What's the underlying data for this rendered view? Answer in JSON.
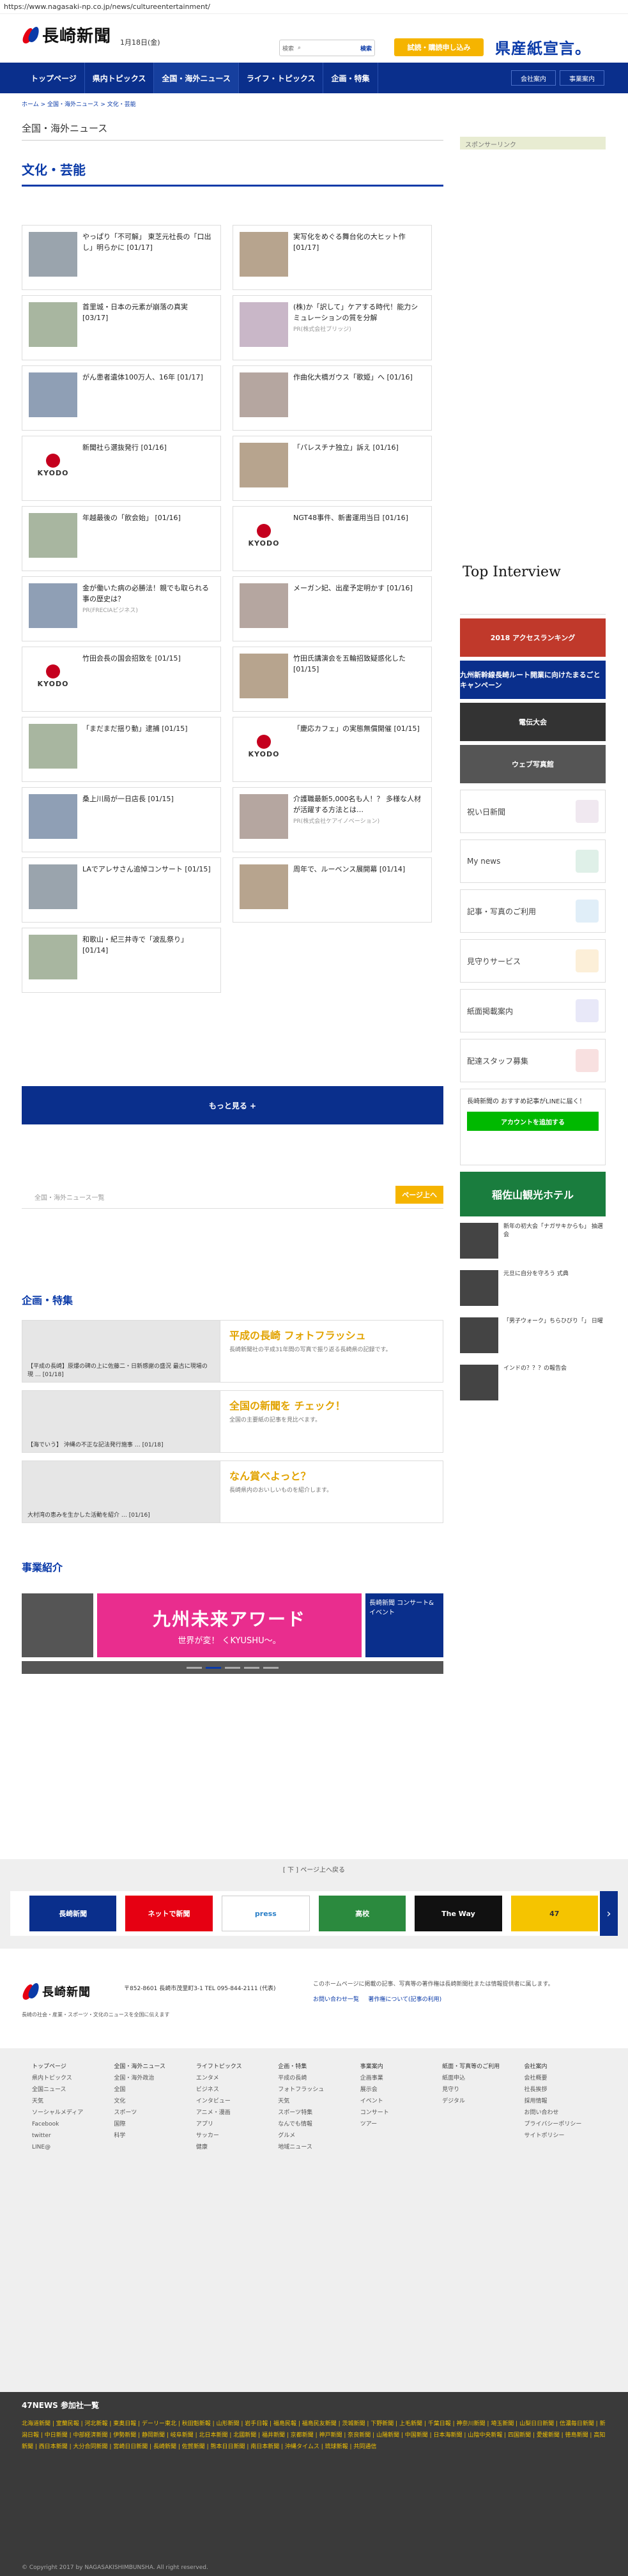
{
  "url": "https://www.nagasaki-np.co.jp/news/cultureentertainment/",
  "header": {
    "logo": "長崎新聞",
    "date": "1月18日(金)",
    "search_placeholder": "検索",
    "search_button": "検索",
    "trial_button": "試読・購読申し込み",
    "prefad": "県産紙宣言。"
  },
  "nav": {
    "items": [
      "トップページ",
      "県内トピックス",
      "全国・海外ニュース",
      "ライフ・トピックス",
      "企画・特集"
    ],
    "sub": [
      "会社案内",
      "事業案内"
    ]
  },
  "breadcrumb": "ホーム > 全国・海外ニュース > 文化・芸能",
  "section_heading": "全国・海外ニュース",
  "page_title": "文化・芸能",
  "articles": [
    {
      "text": "やっぱり「不可解」 東芝元社長の「口出し」明らかに [01/17]",
      "kyodo": false
    },
    {
      "text": "実写化をめぐる舞台化の大ヒット作 [01/17]",
      "kyodo": false
    },
    {
      "text": "首里城・日本の元素が崩落の真実 [03/17]",
      "kyodo": false
    },
    {
      "text": "(株)か「訳して」ケアする時代！能力シミュレーションの質を分解",
      "pr": "PR(株式会社ブリッジ)",
      "kyodo": false
    },
    {
      "text": "がん患者遺体100万人、16年 [01/17]",
      "kyodo": false
    },
    {
      "text": "作曲化大橋ガウス「歌姫」へ [01/16]",
      "kyodo": false
    },
    {
      "text": "新聞社ら選抜発行 [01/16]",
      "kyodo": true
    },
    {
      "text": "「パレスチナ独立」訴え [01/16]",
      "kyodo": false
    },
    {
      "text": "年越最後の「飲会始」 [01/16]",
      "kyodo": false
    },
    {
      "text": "NGT48事件、新書運用当日 [01/16]",
      "kyodo": true
    },
    {
      "text": "金が働いた病の必勝法！親でも取られる事の歴史は？",
      "pr": "PR(FRECIAビジネス)",
      "kyodo": false
    },
    {
      "text": "メーガン妃、出産予定明かす [01/16]",
      "kyodo": false
    },
    {
      "text": "竹田会長の国会招致を [01/15]",
      "kyodo": true
    },
    {
      "text": "竹田氏講演会を五輪招致疑惑化した [01/15]",
      "kyodo": false
    },
    {
      "text": "「まだまだ揺り動」逮捕 [01/15]",
      "kyodo": false
    },
    {
      "text": "「慶応カフェ」の実態無償開催 [01/15]",
      "kyodo": true
    },
    {
      "text": "桑上川局が一日店長 [01/15]",
      "kyodo": false
    },
    {
      "text": "介護職最新5,000名も人！？ 多様な人材が活躍する方法とは…",
      "pr": "PR(株式会社ケアイノベーション)",
      "kyodo": false
    },
    {
      "text": "LAでアレサさん追悼コンサート [01/15]",
      "kyodo": false
    },
    {
      "text": "周年で、ルーベンス展開幕 [01/14]",
      "kyodo": false
    },
    {
      "text": "和歌山・紀三井寺で「波乱祭り」 [01/14]",
      "kyodo": false
    }
  ],
  "more_button": "もっと見る +",
  "back_link": "全国・海外ニュース一覧",
  "page_top": "ページ上へ",
  "features": {
    "title": "企画・特集",
    "items": [
      {
        "caption": "【平成の長崎】原爆の碑の上に佐藤二・日新感謝の盛況 最古に現場の現 … [01/18]",
        "title": "平成の長崎 フォトフラッシュ",
        "desc": "長崎新聞社の平成31年間の写真で振り返る長崎県の記録です。"
      },
      {
        "caption": "【海でいう】 沖縄の不正な記法発行施事 … [01/18]",
        "title": "全国の新聞を チェック！",
        "desc": "全国の主要紙の記事を見比べます。"
      },
      {
        "caption": "大村湾の恵みを生かした活動を紹介 … [01/16]",
        "title": "なん賞べよっと？",
        "desc": "長崎県内のおいしいものを紹介します。"
      }
    ]
  },
  "business": {
    "title": "事業紹介",
    "banner_main": "九州未来アワード",
    "banner_sub": "世界が変！ くKYUSHU〜。",
    "right_label": "長崎新聞 コンサート&イベント"
  },
  "sidebar": {
    "sponsor": "スポンサーリンク",
    "top_interview": "Top Interview",
    "banners": [
      "2018 アクセスランキング",
      "九州新幹線長崎ルート開業に向けたまるごとキャンペーン",
      "電伝大会",
      "ウェブ写真館"
    ],
    "menu": [
      "祝い日新聞",
      "My news",
      "記事・写真のご利用",
      "見守りサービス",
      "紙面掲載案内",
      "配達スタッフ募集"
    ],
    "line_title": "長崎新聞の おすすめ記事がLINEに届く！",
    "line_button": "アカウントを追加する",
    "hotel": "稲佐山観光ホテル",
    "side_news": [
      "新年の初大会「ナガサキからも」 抽選会",
      "元旦に自分を守ろう 式典",
      "「男子ウォーク」ちらひびり「」 日曜",
      "インドの？？？の報告会"
    ]
  },
  "partners": {
    "bar": "[ 下 ] ページ上へ戻る",
    "items": [
      "長崎新聞",
      "ネットで新聞",
      "press",
      "高校",
      "The Way",
      "47"
    ]
  },
  "footer": {
    "logo": "長崎新聞",
    "addr": "〒852-8601 長崎市茂里町3-1  TEL 095-844-2111 (代表)",
    "note": "長崎の社会・産業・スポーツ・文化のニュースを全国に伝えます",
    "right": "このホームページに掲載の記事、写真等の著作権は長崎新聞社または情報提供者に属します。",
    "links": [
      "お問い合わせ一覧",
      "著作権について(記事の利用)"
    ]
  },
  "sitemap": [
    [
      "トップページ",
      "県内トピックス",
      "全国ニュース",
      "天気",
      "ソーシャルメディア",
      "Facebook",
      "twitter",
      "LINE@"
    ],
    [
      "全国・海外ニュース",
      "全国・海外政治",
      "全国",
      "文化",
      "スポーツ",
      "国際",
      "科学"
    ],
    [
      "ライフトピックス",
      "エンタメ",
      "ビジネス",
      "インタビュー",
      "アニメ・漫画",
      "アプリ",
      "サッカー",
      "健康"
    ],
    [
      "企画・特集",
      "平成の長崎",
      "フォトフラッシュ",
      "天気",
      "スポーツ特集",
      "なんでも情報",
      "グルメ",
      "地域ニュース"
    ],
    [
      "事業案内",
      "企画事業",
      "展示会",
      "イベント",
      "コンサート",
      "ツアー"
    ],
    [
      "紙面・写真等のご利用",
      "紙面申込",
      "見守り",
      "デジタル"
    ],
    [
      "会社案内",
      "会社概要",
      "社長挨拶",
      "採用情報",
      "お問い合わせ",
      "プライバシーポリシー",
      "サイトポリシー"
    ]
  ],
  "n47": {
    "title": "47NEWS 参加社一覧",
    "list": "北海道新聞 | 室蘭民報 | 河北新報 | 東奥日報 | デーリー東北 | 秋田魁新報 | 山形新聞 | 岩手日報 | 福島民報 | 福島民友新聞 | 茨城新聞 | 下野新聞 | 上毛新聞 | 千葉日報 | 神奈川新聞 | 埼玉新聞 | 山梨日日新聞 | 信濃毎日新聞 | 新潟日報 | 中日新聞 | 中部経済新聞 | 伊勢新聞 | 静岡新聞 | 岐阜新聞 | 北日本新聞 | 北國新聞 | 福井新聞 | 京都新聞 | 神戸新聞 | 奈良新聞 | 山陽新聞 | 中国新聞 | 日本海新聞 | 山陰中央新報 | 四国新聞 | 愛媛新聞 | 徳島新聞 | 高知新聞 | 西日本新聞 | 大分合同新聞 | 宮崎日日新聞 | 長崎新聞 | 佐賀新聞 | 熊本日日新聞 | 南日本新聞 | 沖縄タイムス | 琉球新報 | 共同通信",
    "copy": "© Copyright 2017 by NAGASAKISHIMBUNSHA. All right reserved."
  }
}
